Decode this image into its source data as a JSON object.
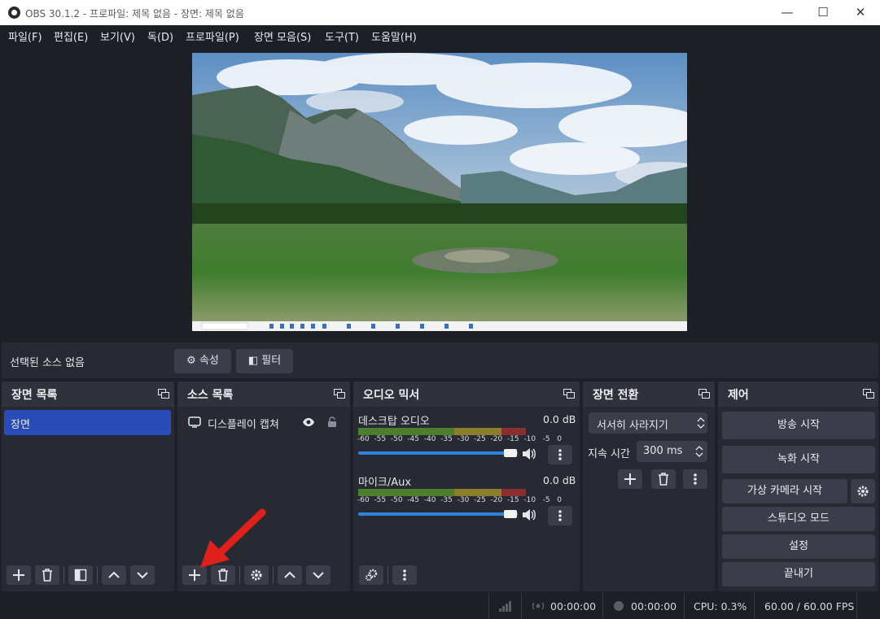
{
  "window": {
    "title": "OBS 30.1.2 - 프로파일: 제목 없음 - 장면: 제목 없음",
    "minimize": "—",
    "maximize": "☐",
    "close": "✕"
  },
  "menu": [
    "파일(F)",
    "편집(E)",
    "보기(V)",
    "독(D)",
    "프로파일(P)",
    "장면 모음(S)",
    "도구(T)",
    "도움말(H)"
  ],
  "context_bar": {
    "no_source": "선택된 소스 없음",
    "properties": "속성",
    "filters": "필터"
  },
  "scenes_dock": {
    "title": "장면 목록",
    "items": [
      "장면"
    ]
  },
  "sources_dock": {
    "title": "소스 목록",
    "items": [
      "디스플레이 캡쳐"
    ]
  },
  "mixer_dock": {
    "title": "오디오 믹서",
    "channels": [
      {
        "name": "데스크탑 오디오",
        "level": "0.0 dB",
        "volume": 0.95
      },
      {
        "name": "마이크/Aux",
        "level": "0.0 dB",
        "volume": 0.95
      }
    ],
    "ticks": [
      "-60",
      "-55",
      "-50",
      "-45",
      "-40",
      "-35",
      "-30",
      "-25",
      "-20",
      "-15",
      "-10",
      "-5",
      "0"
    ]
  },
  "transitions_dock": {
    "title": "장면 전환",
    "transition": "서서히 사라지기",
    "duration_label": "지속 시간",
    "duration_value": "300 ms"
  },
  "controls_dock": {
    "title": "제어",
    "start_streaming": "방송 시작",
    "start_recording": "녹화 시작",
    "start_virtualcam": "가상 카메라 시작",
    "studio_mode": "스튜디오 모드",
    "settings": "설정",
    "exit": "끝내기"
  },
  "statusbar": {
    "stream_time": "00:00:00",
    "record_time": "00:00:00",
    "cpu": "CPU: 0.3%",
    "fps": "60.00 / 60.00 FPS"
  },
  "colors": {
    "accent": "#2a4cb8",
    "panel": "#282a33",
    "background": "#1d1f27",
    "button": "#3b3e4a",
    "annotation_arrow": "#e0201b"
  }
}
